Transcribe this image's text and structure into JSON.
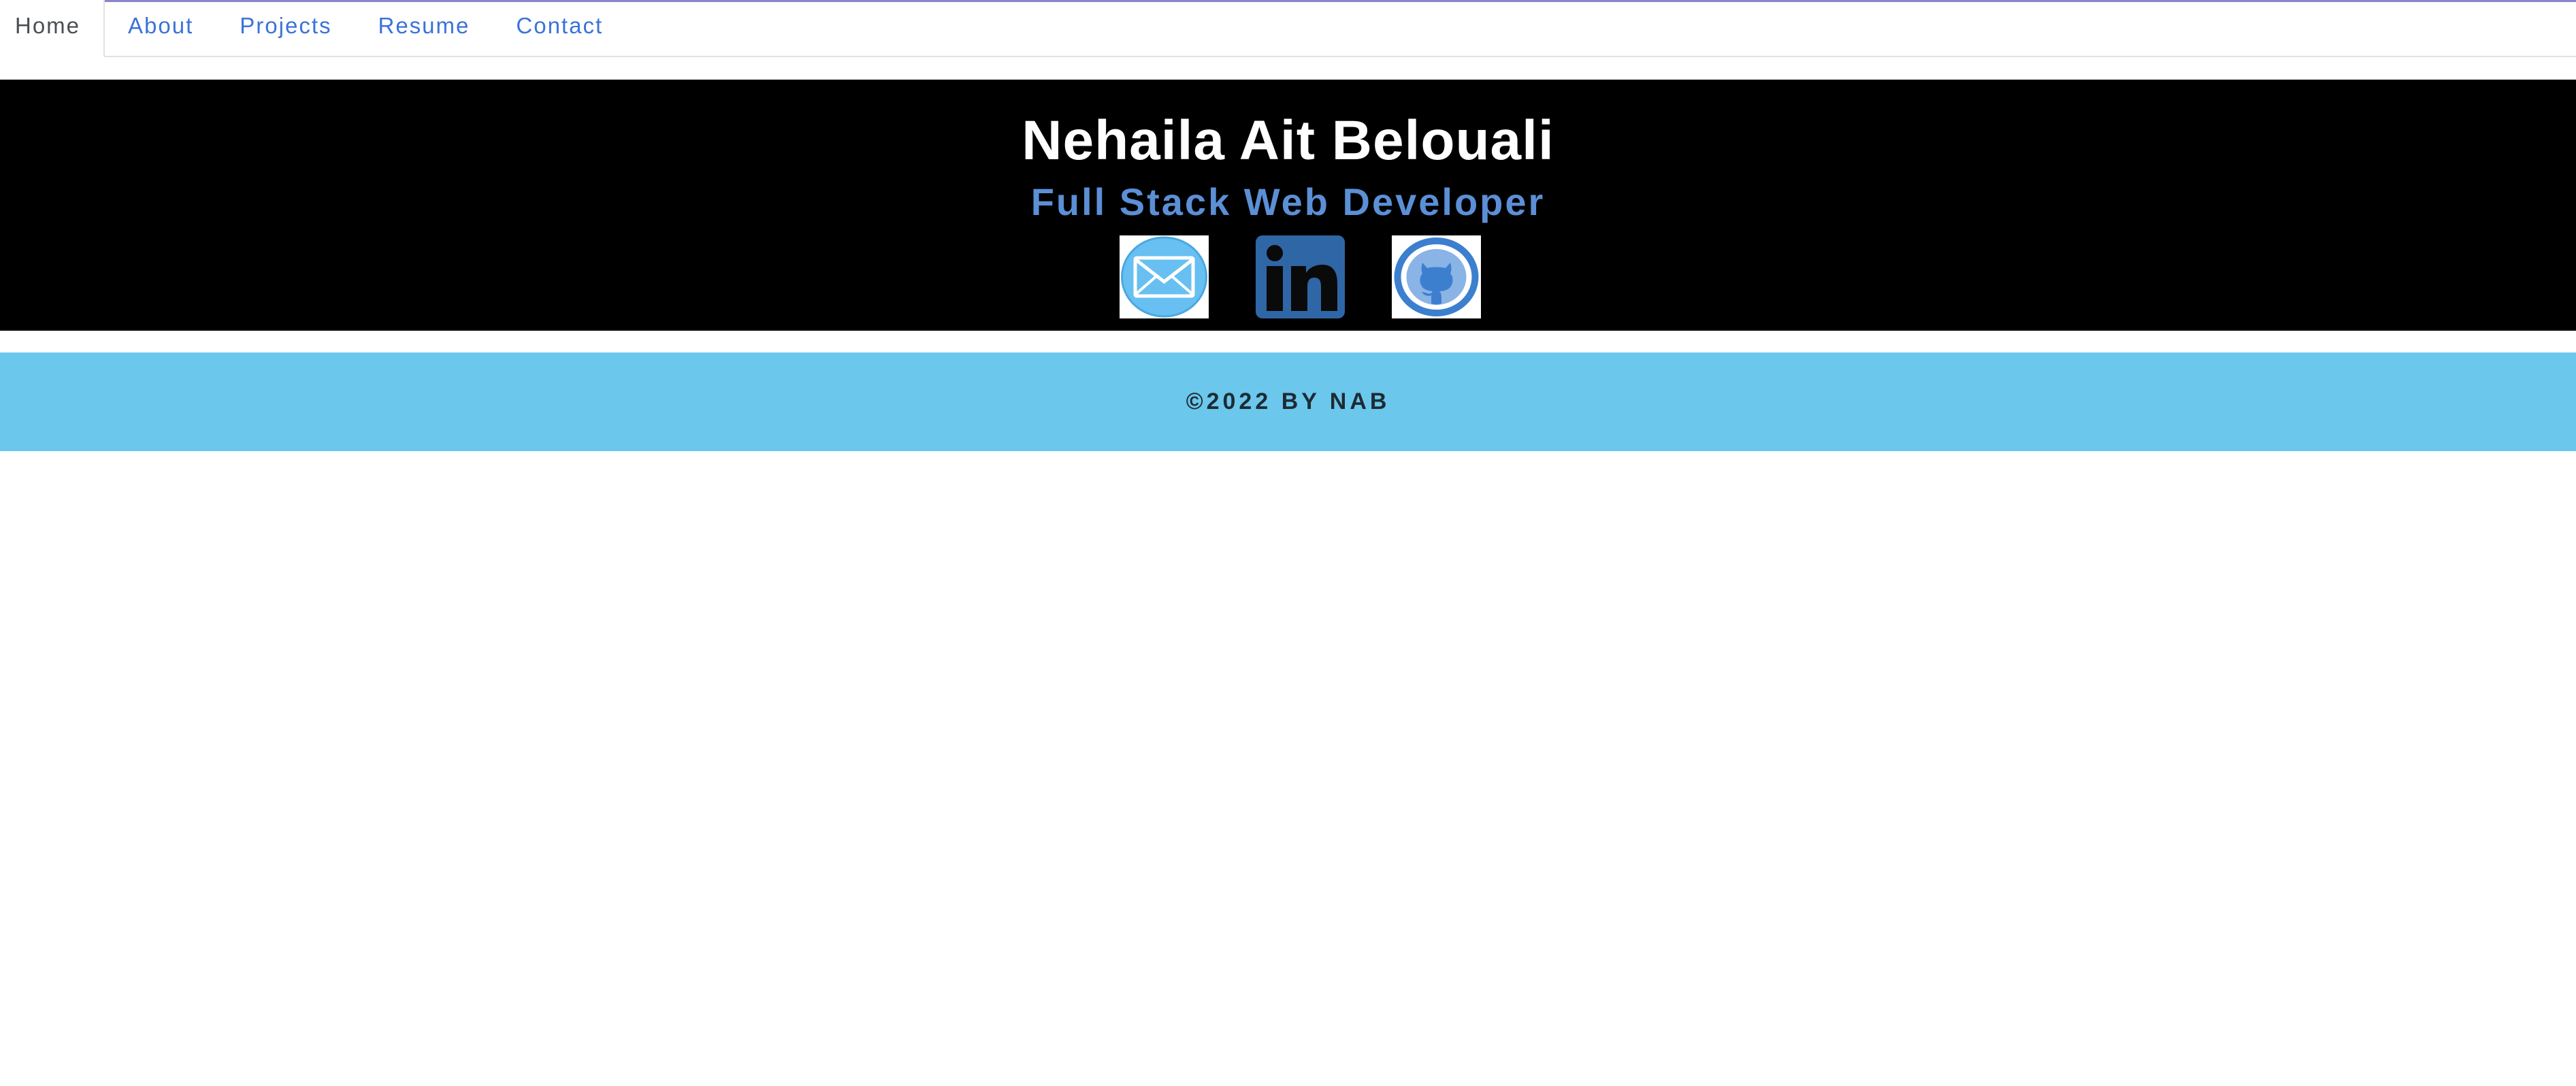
{
  "nav": {
    "items": [
      {
        "label": "Home",
        "active": true
      },
      {
        "label": "About",
        "active": false
      },
      {
        "label": "Projects",
        "active": false
      },
      {
        "label": "Resume",
        "active": false
      },
      {
        "label": "Contact",
        "active": false
      }
    ]
  },
  "hero": {
    "name": "Nehaila Ait Belouali",
    "role": "Full Stack Web Developer",
    "social": [
      {
        "icon": "mail-icon"
      },
      {
        "icon": "linkedin-icon"
      },
      {
        "icon": "github-icon"
      }
    ]
  },
  "footer": {
    "text": "©2022 BY NAB"
  },
  "colors": {
    "accent_link": "#3b73d9",
    "role_text": "#5b8fd6",
    "footer_bg": "#6bc7ec",
    "hero_bg": "#000000"
  }
}
